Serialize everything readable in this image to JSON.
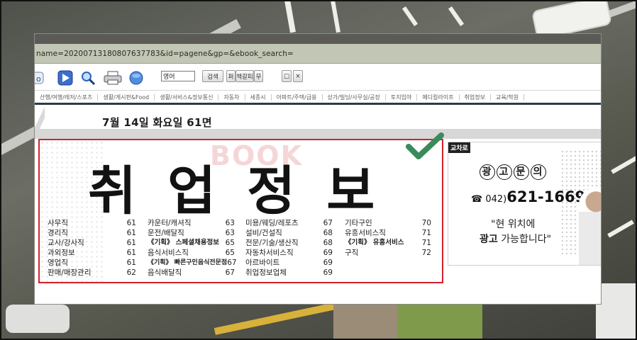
{
  "url_fragment": "name=20200713180807637783&id=pagene&gp=&ebook_search=",
  "toolbar": {
    "search_value": "영어",
    "search_button": "검색",
    "btn_extra1": "퍼",
    "btn_extra2": "책갈피",
    "btn_extra3": "무",
    "btn_window": "□",
    "btn_close": "×"
  },
  "categories": [
    "산행/여행/레저/스포츠",
    "생활/게시판&Food",
    "생활/서비스&정보통신",
    "자동차",
    "세종시",
    "아파트/주택/급용",
    "상가/빌딩/사무실/공장",
    "토지임야",
    "메디컬라이프",
    "취업정보",
    "교육/학원"
  ],
  "page": {
    "header": "7월 14일 화요일   61면",
    "watermark": "BOOK",
    "title": "취업정보"
  },
  "job_columns": [
    [
      {
        "name": "사무직",
        "page": "61"
      },
      {
        "name": "경리직",
        "page": "61"
      },
      {
        "name": "교사/강사직",
        "page": "61"
      },
      {
        "name": "과외정보",
        "page": "61"
      },
      {
        "name": "영업직",
        "page": "61"
      },
      {
        "name": "판매/매장관리",
        "page": "62"
      }
    ],
    [
      {
        "name": "카운터/캐셔직",
        "page": "63"
      },
      {
        "name": "운전/배달직",
        "page": "63"
      },
      {
        "name": "《기획》 스페셜채용정보",
        "page": "65",
        "bold": true
      },
      {
        "name": "음식서비스직",
        "page": "65"
      },
      {
        "name": "《기획》 빠른구인음식전문점",
        "page": "67",
        "bold": true
      },
      {
        "name": "음식배달직",
        "page": "67"
      }
    ],
    [
      {
        "name": "미용/웨딩/레포츠",
        "page": "67"
      },
      {
        "name": "설비/건설직",
        "page": "68"
      },
      {
        "name": "전문/기술/생산직",
        "page": "68"
      },
      {
        "name": "자동차서비스직",
        "page": "69"
      },
      {
        "name": "아르바이트",
        "page": "69"
      },
      {
        "name": "취업정보업체",
        "page": "69"
      }
    ],
    [
      {
        "name": "기타구인",
        "page": "70"
      },
      {
        "name": "유흥서비스직",
        "page": "71"
      },
      {
        "name": "《기획》 유흥서비스",
        "page": "71",
        "bold": true
      },
      {
        "name": "구직",
        "page": "72"
      }
    ]
  ],
  "ad": {
    "tag": "교차로",
    "title": "광고문의",
    "title_chars": [
      "광",
      "고",
      "문",
      "의"
    ],
    "phone_prefix": "☎ 042)",
    "phone_number": "621-1669",
    "slogan_line1": "\"현 위치에",
    "slogan_line2_bold": "광고",
    "slogan_line2_rest": " 가능합니다\""
  },
  "colors": {
    "highlight_border": "#d0222d",
    "checkmark": "#3a8a5a",
    "urlbar": "#c2c6b4"
  }
}
